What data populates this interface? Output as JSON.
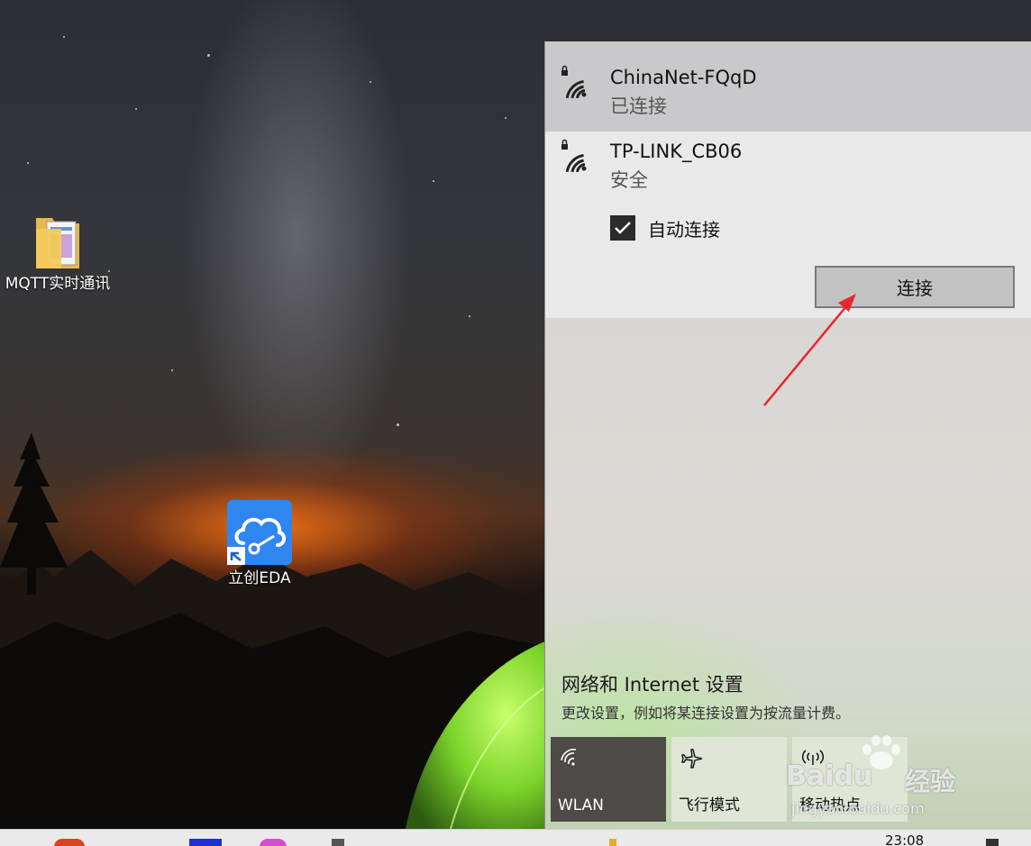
{
  "desktop": {
    "icons": [
      {
        "label": "MQTT实时通讯",
        "icon": "folder-icon"
      },
      {
        "label": "立创EDA",
        "icon": "lceda-cloud-icon"
      }
    ]
  },
  "wifi_flyout": {
    "networks": [
      {
        "name": "ChinaNet-FQqD",
        "status": "已连接",
        "secured": true
      },
      {
        "name": "TP-LINK_CB06",
        "status": "安全",
        "secured": true,
        "auto_connect_label": "自动连接",
        "auto_connect_checked": true,
        "connect_button": "连接"
      }
    ],
    "settings": {
      "title": "网络和 Internet 设置",
      "description": "更改设置，例如将某连接设置为按流量计费。"
    },
    "quick_actions": [
      {
        "label": "WLAN",
        "icon": "wifi-icon",
        "active": true
      },
      {
        "label": "飞行模式",
        "icon": "airplane-icon",
        "active": false
      },
      {
        "label": "移动热点",
        "icon": "hotspot-icon",
        "active": false
      }
    ]
  },
  "watermark": {
    "brand": "Baidu",
    "brand_cn": "经验",
    "url": "jingyan.baidu.com"
  },
  "taskbar": {
    "clock": "23:08"
  },
  "colors": {
    "annotation_arrow": "#e8262b",
    "active_tile": "#4d4a48"
  }
}
